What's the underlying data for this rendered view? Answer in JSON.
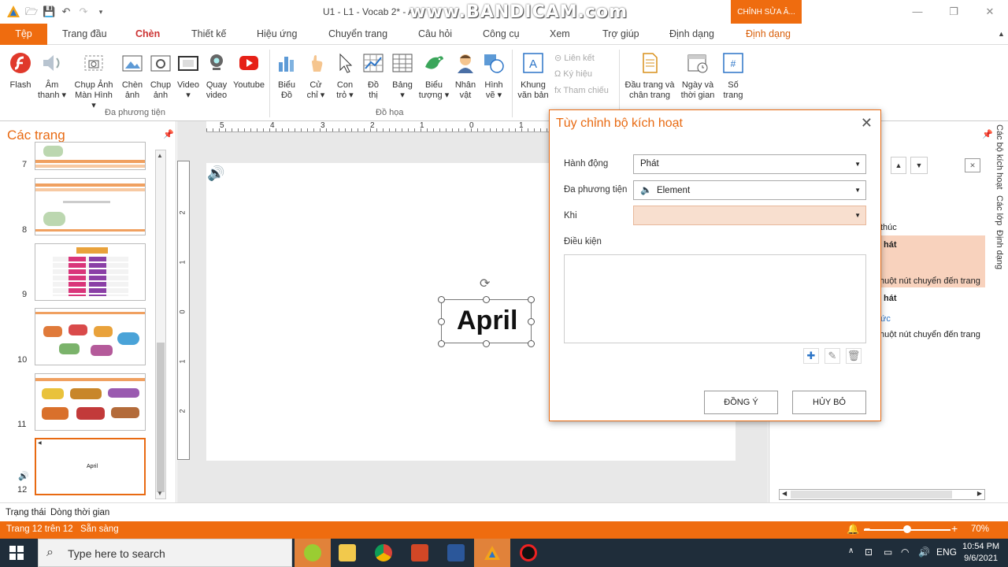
{
  "titlebar": {
    "title": "U1 - L1 - Vocab 2* - A",
    "watermark": "www.BANDICAM.com",
    "context_tab": "CHỈNH SỬA Â..."
  },
  "menu": {
    "file": "Tệp",
    "tabs": [
      "Trang đầu",
      "Chèn",
      "Thiết kế",
      "Hiệu ứng",
      "Chuyển trang",
      "Câu hỏi",
      "Công cụ",
      "Xem",
      "Trợ giúp",
      "Định dạng",
      "Định dạng"
    ]
  },
  "ribbon": {
    "flash": "Flash",
    "am_thanh": [
      "Âm",
      "thanh ▾"
    ],
    "chup_man_hinh": [
      "Chụp Ảnh",
      "Màn Hình ▾"
    ],
    "chen_anh": [
      "Chèn",
      "ảnh"
    ],
    "chup_anh": [
      "Chụp",
      "ảnh"
    ],
    "video": [
      "Video",
      "▾"
    ],
    "quay_video": [
      "Quay",
      "video"
    ],
    "youtube": "Youtube",
    "group_media": "Đa phương tiện",
    "bieu_do": [
      "Biểu",
      "Đồ"
    ],
    "cu_chi": [
      "Cử",
      "chỉ ▾"
    ],
    "con_tro": [
      "Con",
      "trỏ ▾"
    ],
    "do_thi": [
      "Đồ",
      "thị"
    ],
    "bang": [
      "Bảng",
      "▾"
    ],
    "bieu_tuong": [
      "Biểu",
      "tượng ▾"
    ],
    "nhan_vat": [
      "Nhân",
      "vật"
    ],
    "hinh_ve": [
      "Hình",
      "vẽ ▾"
    ],
    "group_graphics": "Đồ họa",
    "khung_van_ban": [
      "Khung",
      "văn bản"
    ],
    "lien_ket": "Liên kết",
    "ky_hieu": "Ký hiệu",
    "tham_chieu": "Tham chiếu",
    "dau_trang": [
      "Đầu trang và",
      "chân trang"
    ],
    "ngay_thoi_gian": [
      "Ngày và",
      "thời gian"
    ],
    "so_trang": [
      "Số",
      "trang"
    ]
  },
  "leftpane": {
    "title": "Các trang",
    "slides": [
      "7",
      "8",
      "9",
      "10",
      "11",
      "12"
    ],
    "selected_thumb_text": "April"
  },
  "slide": {
    "text": "April"
  },
  "ruler": {
    "h": [
      "5",
      "4",
      "3",
      "2",
      "1",
      "0",
      "1"
    ],
    "v": [
      "2",
      "1",
      "0",
      "1",
      "2"
    ]
  },
  "dialog": {
    "title": "Tùy chỉnh bộ kích hoạt",
    "action_label": "Hành động",
    "action_value": "Phát",
    "media_label": "Đa phương tiện",
    "media_value": "Element",
    "when_label": "Khi",
    "when_value": "",
    "condition_label": "Điều kiện",
    "ok": "ĐỒNG Ý",
    "cancel": "HỦY BỎ"
  },
  "rightpane": {
    "texts": [
      "thúc",
      "hát",
      "huột nút chuyển đến trang",
      "hát",
      "ức",
      "huột nút chuyển đến trang"
    ],
    "vtabs": [
      "Các bộ kích hoạt",
      "Các lớp",
      "Định dạng"
    ]
  },
  "status": {
    "state": "Trạng thái",
    "timeline": "Dòng thời gian",
    "page": "Trang 12 trên 12",
    "ready": "Sẵn sàng",
    "zoom": "70%",
    "zoom_level": 0.5
  },
  "taskbar": {
    "search": "Type here to search",
    "lang": "ENG",
    "time": "10:54 PM",
    "date": "9/6/2021"
  }
}
